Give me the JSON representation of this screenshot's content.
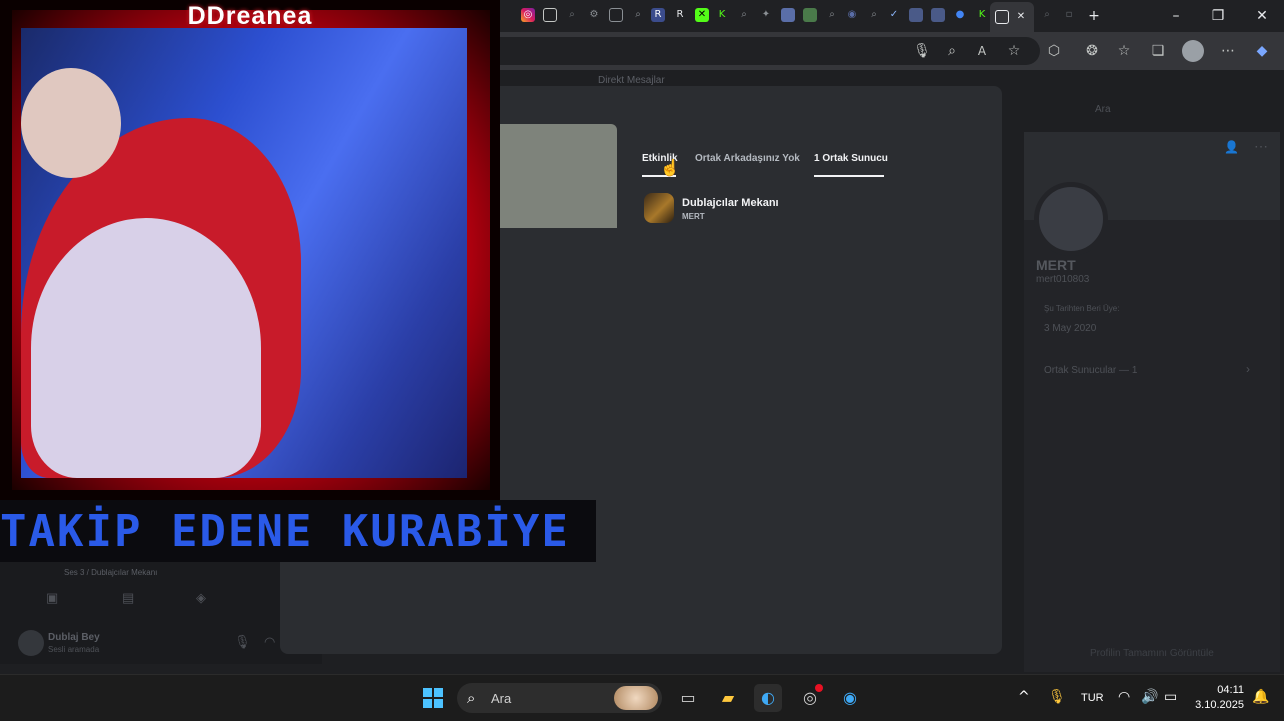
{
  "overlay": {
    "title": "DDreanea",
    "banner_text": "TAKİP EDENE KURABİYE"
  },
  "browser": {
    "tab_icons": [
      "instagram-icon",
      "tab-icon",
      "search-icon",
      "settings-icon",
      "tab-icon",
      "r-icon",
      "r-icon",
      "x-icon",
      "k-icon",
      "search-icon",
      "puzzle-icon",
      "tab-icon",
      "tab-icon",
      "search-icon",
      "search-icon",
      "check-icon",
      "tab-icon",
      "tab-icon",
      "circle-icon",
      "k-icon",
      "tab-icon"
    ],
    "new_tab": "+",
    "minimize": "–",
    "restore": "❐",
    "close": "✕"
  },
  "discord": {
    "dm_label": "Direkt Mesajlar",
    "search_placeholder": "Ara",
    "profile_tabs": [
      {
        "label": "Etkinlik",
        "active": true
      },
      {
        "label": "Ortak Arkadaşınız Yok",
        "active": false
      },
      {
        "label": "1 Ortak Sunucu",
        "active": true
      }
    ],
    "server": {
      "name": "Dublajcılar Mekanı",
      "subtitle": "MERT"
    },
    "right_panel": {
      "display_name": "MERT",
      "username": "mert010803",
      "member_since_label": "Şu Tarihten Beri Üye:",
      "member_since": "3 May 2020",
      "mutual_servers": "Ortak Sunucular — 1",
      "view_full_profile": "Profilin Tamamını Görüntüle"
    },
    "voice": {
      "channel": "Ses 3 / Dublajcılar Mekanı"
    },
    "user_panel": {
      "name": "Dublaj Bey",
      "status": "Sesli aramada"
    }
  },
  "taskbar": {
    "search_label": "Ara",
    "language": "TUR",
    "time": "04:11",
    "date": "3.10.2025"
  },
  "colors": {
    "overlay_red": "#c00010",
    "banner_blue": "#2a5ae8",
    "discord_bg": "#1e1f22",
    "modal_bg": "#2b2d31"
  }
}
